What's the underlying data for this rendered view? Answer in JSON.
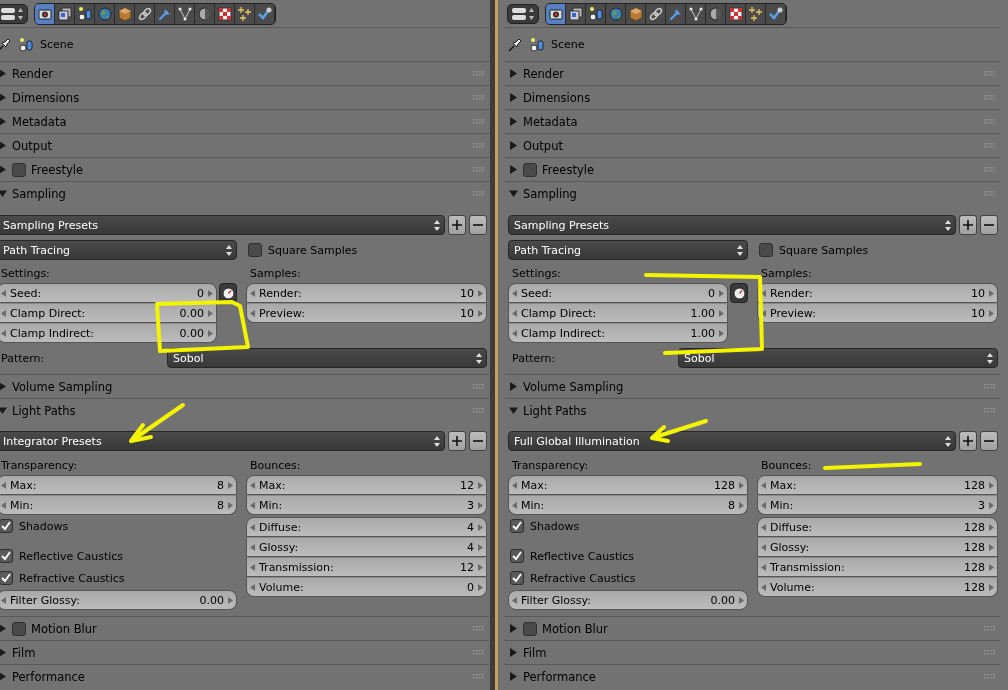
{
  "panels": [
    {
      "tabs": [
        {
          "selected": true
        },
        {
          "selected": false
        },
        {
          "selected": false
        },
        {
          "selected": false
        },
        {
          "selected": false
        },
        {
          "selected": false
        },
        {
          "selected": false
        },
        {
          "selected": false
        },
        {
          "selected": false
        },
        {
          "selected": false
        },
        {
          "selected": false
        },
        {
          "selected": false
        }
      ],
      "breadcrumb": "Scene",
      "sections": [
        {
          "kind": "plain",
          "title": "Render",
          "expanded": false
        },
        {
          "kind": "plain",
          "title": "Dimensions",
          "expanded": false
        },
        {
          "kind": "plain",
          "title": "Metadata",
          "expanded": false
        },
        {
          "kind": "plain",
          "title": "Output",
          "expanded": false
        },
        {
          "kind": "toggle",
          "title": "Freestyle",
          "expanded": false,
          "enabled": false
        },
        {
          "kind": "sampling",
          "title": "Sampling",
          "expanded": true,
          "presets": "Sampling Presets",
          "integrator": "Path Tracing",
          "square_samples": {
            "label": "Square Samples",
            "checked": false
          },
          "settings": {
            "label": "Settings:",
            "fields": [
              {
                "label": "Seed:",
                "value": "0"
              },
              {
                "label": "Clamp Direct:",
                "value": "0.00"
              },
              {
                "label": "Clamp Indirect:",
                "value": "0.00"
              }
            ]
          },
          "samples": {
            "label": "Samples:",
            "fields": [
              {
                "label": "Render:",
                "value": "10"
              },
              {
                "label": "Preview:",
                "value": "10"
              }
            ]
          },
          "pattern": {
            "label": "Pattern:",
            "value": "Sobol"
          }
        },
        {
          "kind": "plain",
          "title": "Volume Sampling",
          "expanded": false
        },
        {
          "kind": "light_paths",
          "title": "Light Paths",
          "expanded": true,
          "presets": "Integrator Presets",
          "transparency": {
            "label": "Transparency:",
            "fields": [
              {
                "label": "Max:",
                "value": "8"
              },
              {
                "label": "Min:",
                "value": "8"
              }
            ]
          },
          "toggles": [
            {
              "label": "Shadows",
              "checked": true
            },
            {
              "label": "Reflective Caustics",
              "checked": true
            },
            {
              "label": "Refractive Caustics",
              "checked": true
            }
          ],
          "filter_glossy": {
            "label": "Filter Glossy:",
            "value": "0.00"
          },
          "bounces": {
            "label": "Bounces:",
            "fields": [
              {
                "label": "Max:",
                "value": "12"
              },
              {
                "label": "Min:",
                "value": "3"
              }
            ],
            "types": [
              {
                "label": "Diffuse:",
                "value": "4"
              },
              {
                "label": "Glossy:",
                "value": "4"
              },
              {
                "label": "Transmission:",
                "value": "12"
              },
              {
                "label": "Volume:",
                "value": "0"
              }
            ]
          }
        },
        {
          "kind": "toggle",
          "title": "Motion Blur",
          "expanded": false,
          "enabled": false
        },
        {
          "kind": "plain",
          "title": "Film",
          "expanded": false
        },
        {
          "kind": "plain",
          "title": "Performance",
          "expanded": false
        }
      ],
      "annotations": [
        {
          "kind": "box"
        },
        {
          "kind": "arrow"
        }
      ]
    },
    {
      "tabs": [
        {
          "selected": true
        },
        {
          "selected": false
        },
        {
          "selected": false
        },
        {
          "selected": false
        },
        {
          "selected": false
        },
        {
          "selected": false
        },
        {
          "selected": false
        },
        {
          "selected": false
        },
        {
          "selected": false
        },
        {
          "selected": false
        },
        {
          "selected": false
        },
        {
          "selected": false
        }
      ],
      "breadcrumb": "Scene",
      "sections": [
        {
          "kind": "plain",
          "title": "Render",
          "expanded": false
        },
        {
          "kind": "plain",
          "title": "Dimensions",
          "expanded": false
        },
        {
          "kind": "plain",
          "title": "Metadata",
          "expanded": false
        },
        {
          "kind": "plain",
          "title": "Output",
          "expanded": false
        },
        {
          "kind": "toggle",
          "title": "Freestyle",
          "expanded": false,
          "enabled": false
        },
        {
          "kind": "sampling",
          "title": "Sampling",
          "expanded": true,
          "presets": "Sampling Presets",
          "integrator": "Path Tracing",
          "square_samples": {
            "label": "Square Samples",
            "checked": false
          },
          "settings": {
            "label": "Settings:",
            "fields": [
              {
                "label": "Seed:",
                "value": "0"
              },
              {
                "label": "Clamp Direct:",
                "value": "1.00"
              },
              {
                "label": "Clamp Indirect:",
                "value": "1.00"
              }
            ]
          },
          "samples": {
            "label": "Samples:",
            "fields": [
              {
                "label": "Render:",
                "value": "10"
              },
              {
                "label": "Preview:",
                "value": "10"
              }
            ]
          },
          "pattern": {
            "label": "Pattern:",
            "value": "Sobol"
          }
        },
        {
          "kind": "plain",
          "title": "Volume Sampling",
          "expanded": false
        },
        {
          "kind": "light_paths",
          "title": "Light Paths",
          "expanded": true,
          "presets": "Full Global Illumination",
          "transparency": {
            "label": "Transparency:",
            "fields": [
              {
                "label": "Max:",
                "value": "128"
              },
              {
                "label": "Min:",
                "value": "8"
              }
            ]
          },
          "toggles": [
            {
              "label": "Shadows",
              "checked": true
            },
            {
              "label": "Reflective Caustics",
              "checked": true
            },
            {
              "label": "Refractive Caustics",
              "checked": true
            }
          ],
          "filter_glossy": {
            "label": "Filter Glossy:",
            "value": "0.00"
          },
          "bounces": {
            "label": "Bounces:",
            "fields": [
              {
                "label": "Max:",
                "value": "128"
              },
              {
                "label": "Min:",
                "value": "3"
              }
            ],
            "types": [
              {
                "label": "Diffuse:",
                "value": "128"
              },
              {
                "label": "Glossy:",
                "value": "128"
              },
              {
                "label": "Transmission:",
                "value": "128"
              },
              {
                "label": "Volume:",
                "value": "128"
              }
            ]
          }
        },
        {
          "kind": "toggle",
          "title": "Motion Blur",
          "expanded": false,
          "enabled": false
        },
        {
          "kind": "plain",
          "title": "Film",
          "expanded": false
        },
        {
          "kind": "plain",
          "title": "Performance",
          "expanded": false
        }
      ],
      "annotations": [
        {
          "kind": "box"
        },
        {
          "kind": "arrow"
        },
        {
          "kind": "underline"
        }
      ]
    }
  ]
}
